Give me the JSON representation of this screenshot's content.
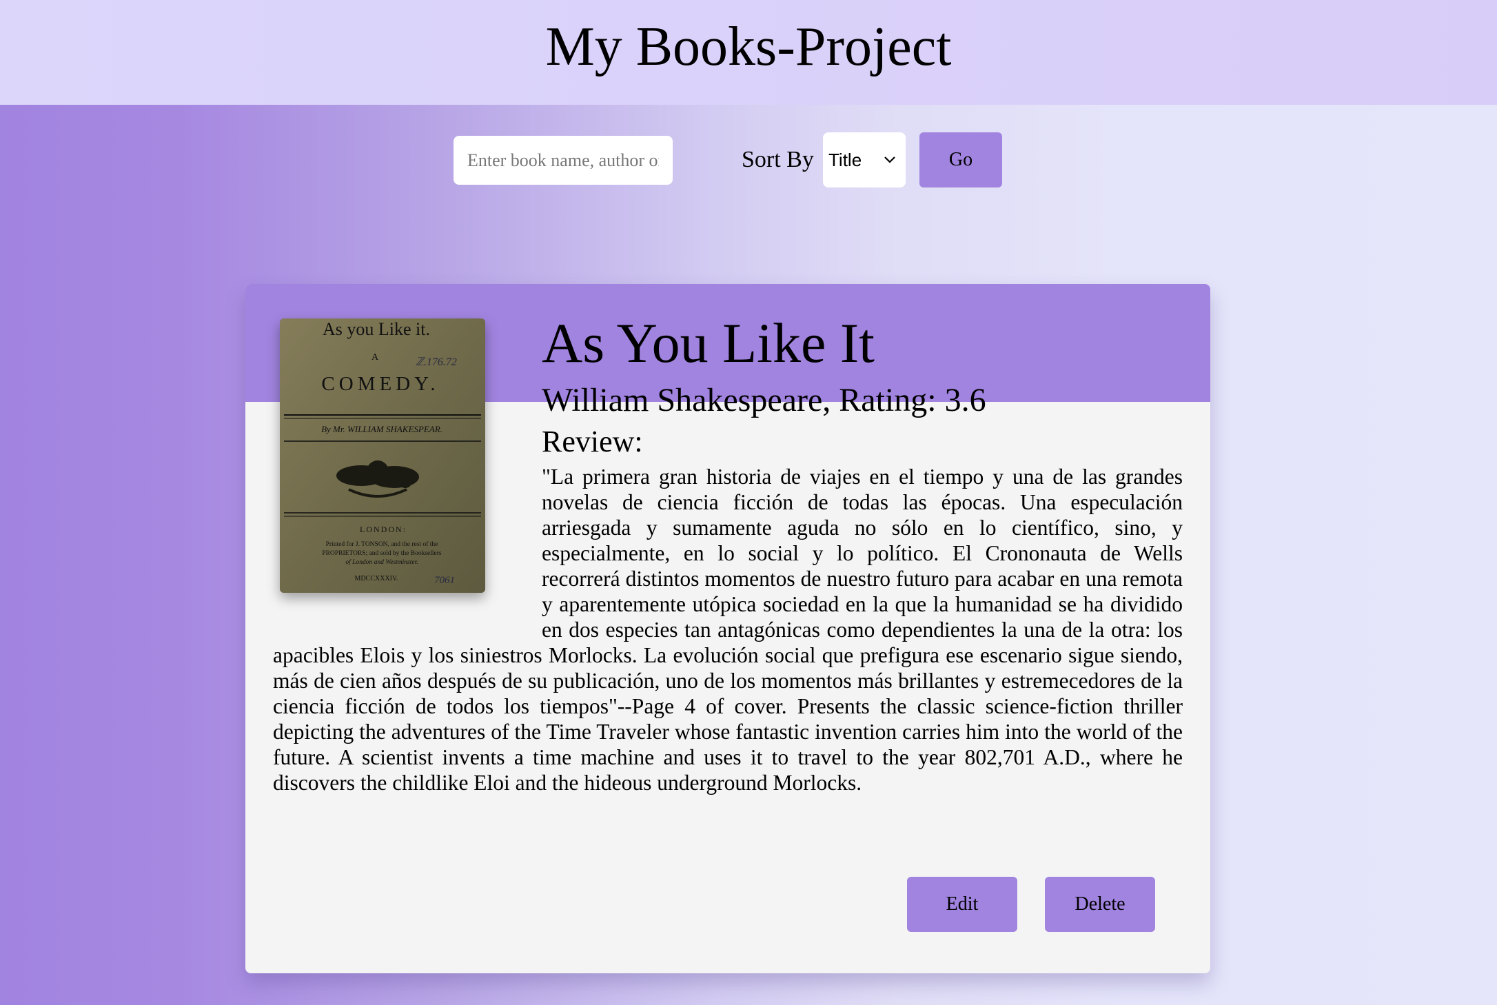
{
  "header": {
    "title": "My Books-Project"
  },
  "toolbar": {
    "search_placeholder": "Enter book name, author or genre",
    "sort_label": "Sort By",
    "sort_selected": "Title",
    "go_label": "Go"
  },
  "book": {
    "title": "As You Like It",
    "author_rating": "William Shakespeare, Rating: 3.6",
    "review_label": "Review:",
    "review_text": "\"La primera gran historia de viajes en el tiempo y una de las grandes novelas de ciencia ficción de todas las épocas. Una especulación arriesgada y sumamente aguda no sólo en lo científico, sino, y especialmente, en lo social y lo político. El Crononauta de Wells recorrerá distintos momentos de nuestro futuro para acabar en una remota y aparentemente utópica sociedad en la que la humanidad se ha dividido en dos especies tan antagónicas como dependientes la una de la otra: los apacibles Elois y los siniestros Morlocks. La evolución social que prefigura ese escenario sigue siendo, más de cien años después de su publicación, uno de los momentos más brillantes y estremecedores de la ciencia ficción de todos los tiempos\"--Page 4 of cover. Presents the classic science-fiction thriller depicting the adventures of the Time Traveler whose fantastic invention carries him into the world of the future. A scientist invents a time machine and uses it to travel to the year 802,701 A.D., where he discovers the childlike Eloi and the hideous underground Morlocks.",
    "cover": {
      "line1": "As you Like it.",
      "line2": "A",
      "line3": "COMEDY.",
      "line4": "By Mr. WILLIAM SHAKESPEAR.",
      "line5": "LONDON:",
      "line6": "Printed for J. TONSON, and the rest of the",
      "line7": "PROPRIETORS; and sold by the Booksellers",
      "line8": "of London and Westminster.",
      "line9": "MDCCXXXIV."
    },
    "edit_label": "Edit",
    "delete_label": "Delete"
  },
  "colors": {
    "accent": "#a184e0",
    "header_bg": "#dcd6fb",
    "card_bg": "#f4f4f4"
  }
}
